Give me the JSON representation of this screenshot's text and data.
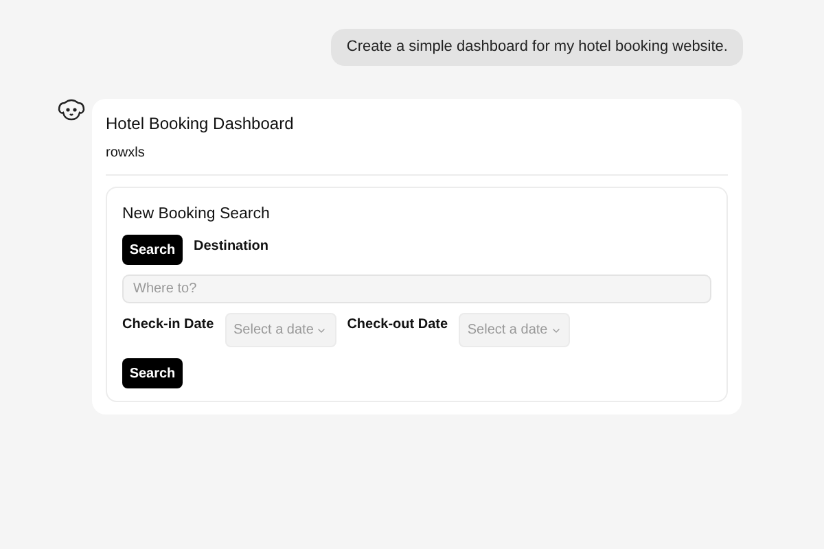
{
  "user_message": "Create a simple dashboard for my hotel booking website.",
  "reply": {
    "title": "Hotel Booking Dashboard",
    "subtitle": "rowxls",
    "search_card": {
      "heading": "New Booking Search",
      "tab_button": "Search",
      "destination_label": "Destination",
      "destination": {
        "placeholder": "Where to?"
      },
      "date_fields": [
        {
          "label": "Check-in Date",
          "placeholder": "Select a date"
        },
        {
          "label": "Check-out Date",
          "placeholder": "Select a date"
        }
      ],
      "submit_button": "Search"
    }
  }
}
